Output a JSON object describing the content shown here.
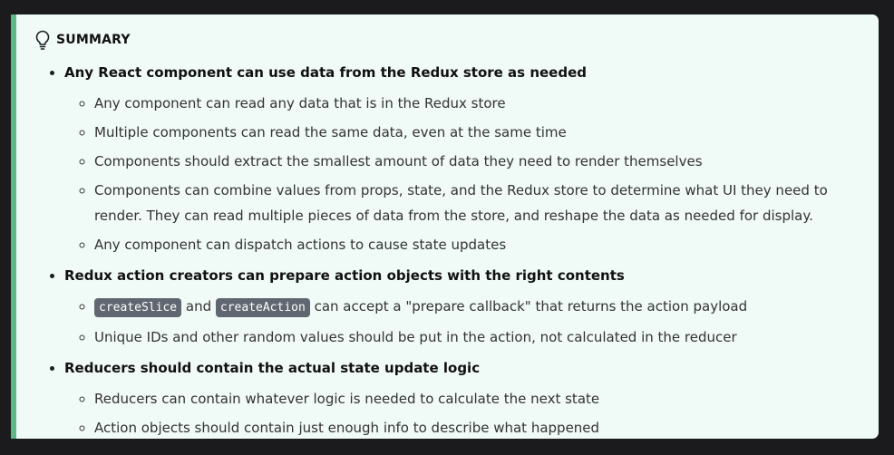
{
  "admonition": {
    "title": "SUMMARY",
    "accent_color": "#5cb885",
    "icon": "lightbulb-icon",
    "sections": [
      {
        "lead": "Any React component can use data from the Redux store as needed",
        "items": [
          "Any component can read any data that is in the Redux store",
          "Multiple components can read the same data, even at the same time",
          "Components should extract the smallest amount of data they need to render themselves",
          "Components can combine values from props, state, and the Redux store to determine what UI they need to render. They can read multiple pieces of data from the store, and reshape the data as needed for display.",
          "Any component can dispatch actions to cause state updates"
        ]
      },
      {
        "lead": "Redux action creators can prepare action objects with the right contents",
        "code_item": {
          "code1": "createSlice",
          "mid": "and",
          "code2": "createAction",
          "rest": "can accept a \"prepare callback\" that returns the action payload"
        },
        "items": [
          "Unique IDs and other random values should be put in the action, not calculated in the reducer"
        ]
      },
      {
        "lead": "Reducers should contain the actual state update logic",
        "items": [
          "Reducers can contain whatever logic is needed to calculate the next state",
          "Action objects should contain just enough info to describe what happened"
        ]
      }
    ]
  }
}
